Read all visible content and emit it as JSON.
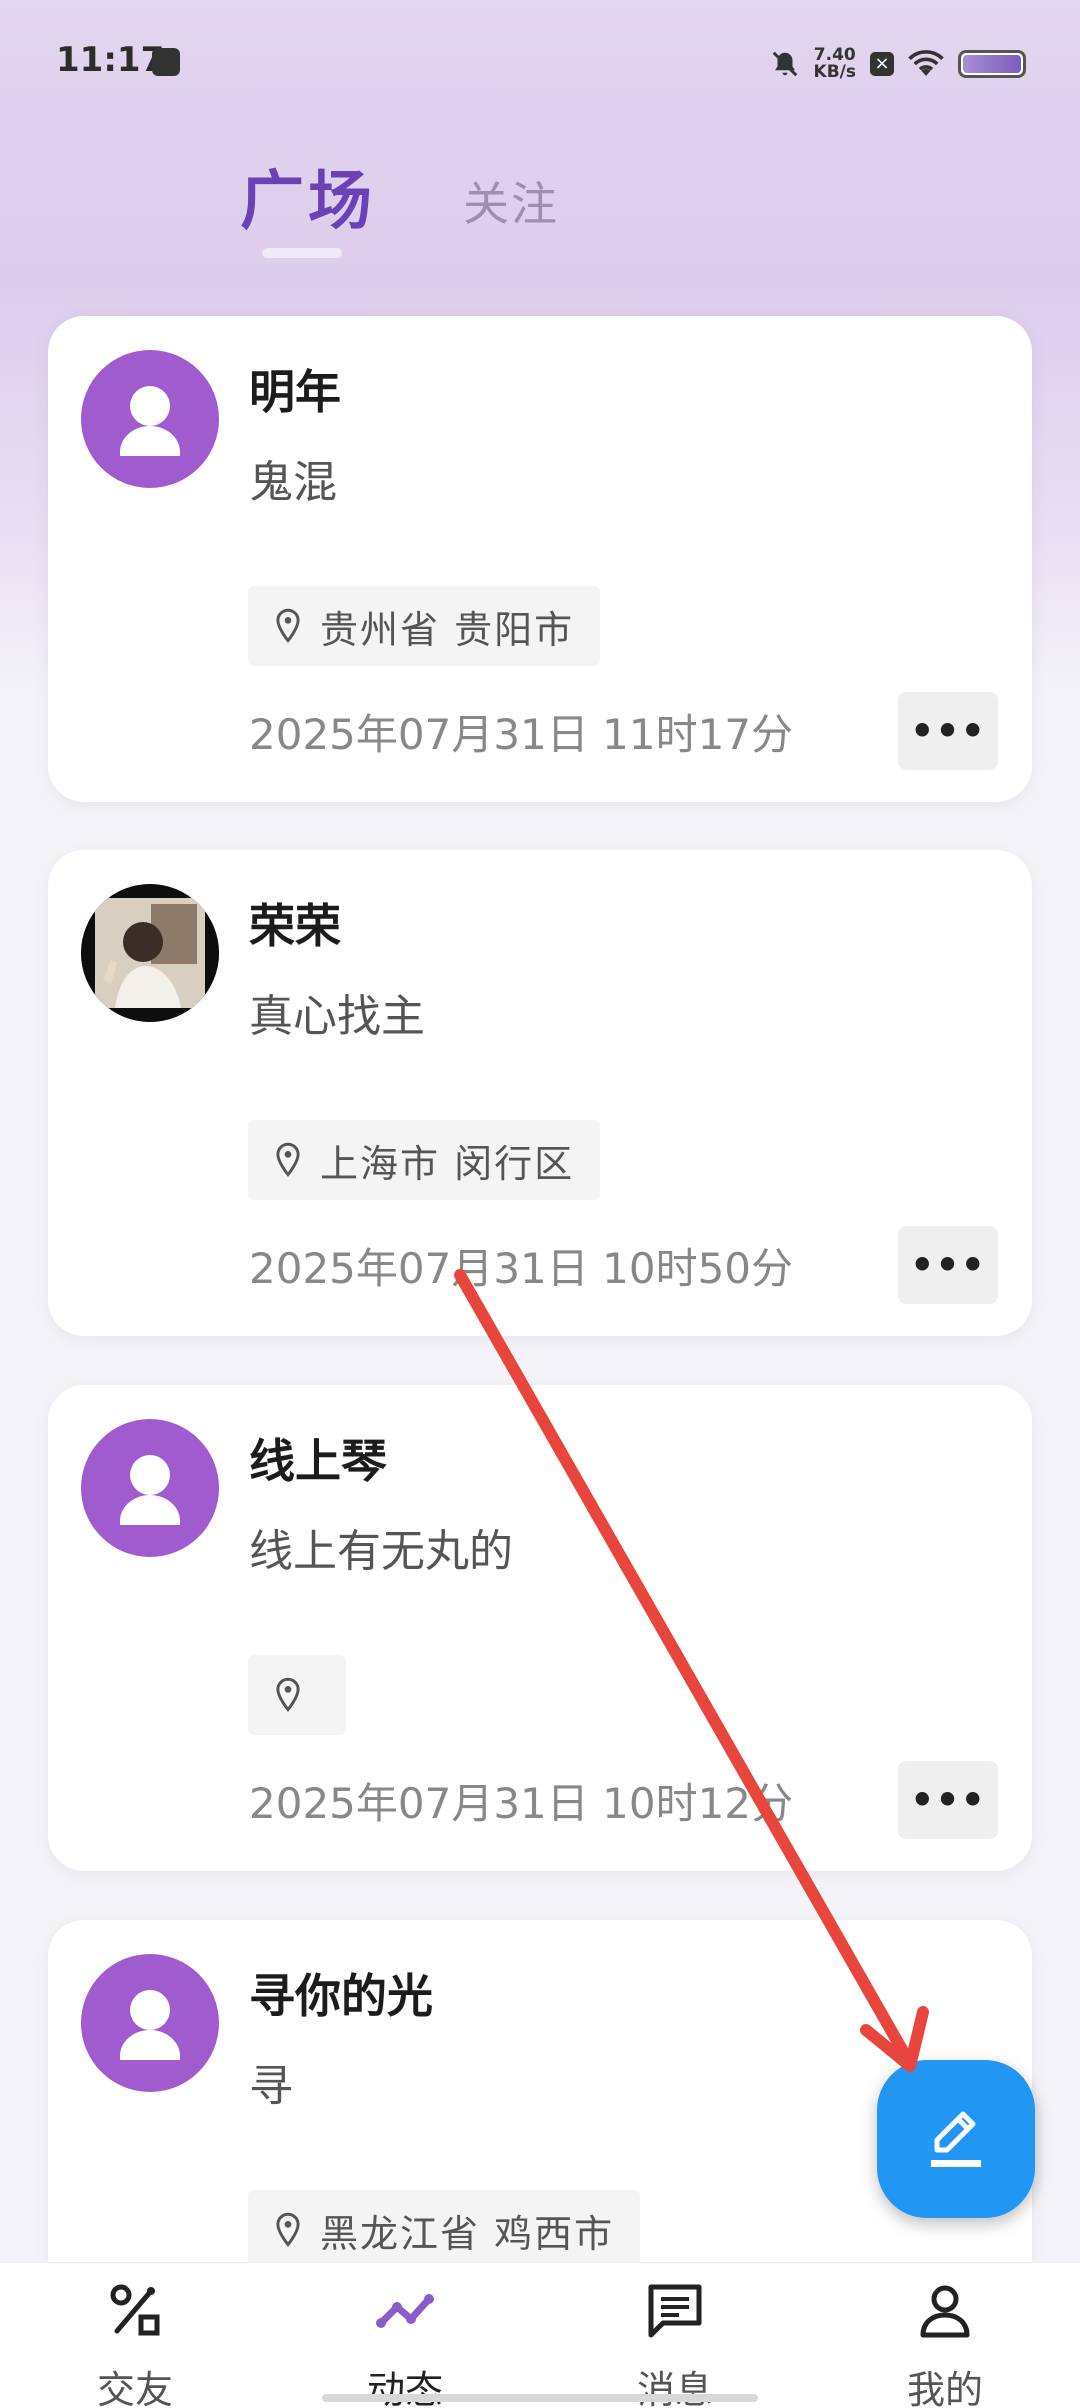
{
  "status_bar": {
    "time": "11:17",
    "net_speed_value": "7.40",
    "net_speed_unit": "KB/s",
    "icons": [
      "app-notification-icon",
      "mute-icon",
      "close-box-icon",
      "wifi-icon",
      "battery-icon"
    ]
  },
  "header": {
    "tabs": [
      {
        "label": "广场",
        "active": true
      },
      {
        "label": "关注",
        "active": false
      }
    ]
  },
  "posts": [
    {
      "username": "明年",
      "content": "鬼混",
      "location": "贵州省 贵阳市",
      "timestamp": "2025年07月31日 11时17分",
      "avatar": "default"
    },
    {
      "username": "荣荣",
      "content": "真心找主",
      "location": "上海市 闵行区",
      "timestamp": "2025年07月31日 10时50分",
      "avatar": "photo"
    },
    {
      "username": "线上琴",
      "content": "线上有无丸的",
      "location": "",
      "timestamp": "2025年07月31日 10时12分",
      "avatar": "default"
    },
    {
      "username": "寻你的光",
      "content": "寻",
      "location": "黑龙江省 鸡西市",
      "timestamp": "",
      "avatar": "default"
    }
  ],
  "more_label": "•••",
  "fab": {
    "icon": "edit-pencil-icon",
    "color": "#2196f3"
  },
  "bottom_nav": {
    "items": [
      {
        "label": "交友",
        "icon": "friends-icon",
        "active": false
      },
      {
        "label": "动态",
        "icon": "trend-icon",
        "active": true
      },
      {
        "label": "消息",
        "icon": "message-icon",
        "active": false
      },
      {
        "label": "我的",
        "icon": "profile-icon",
        "active": false
      }
    ]
  },
  "colors": {
    "accent": "#6a42b5",
    "avatar": "#a05bcf",
    "fab": "#2196f3",
    "annotation": "#e8453c"
  }
}
